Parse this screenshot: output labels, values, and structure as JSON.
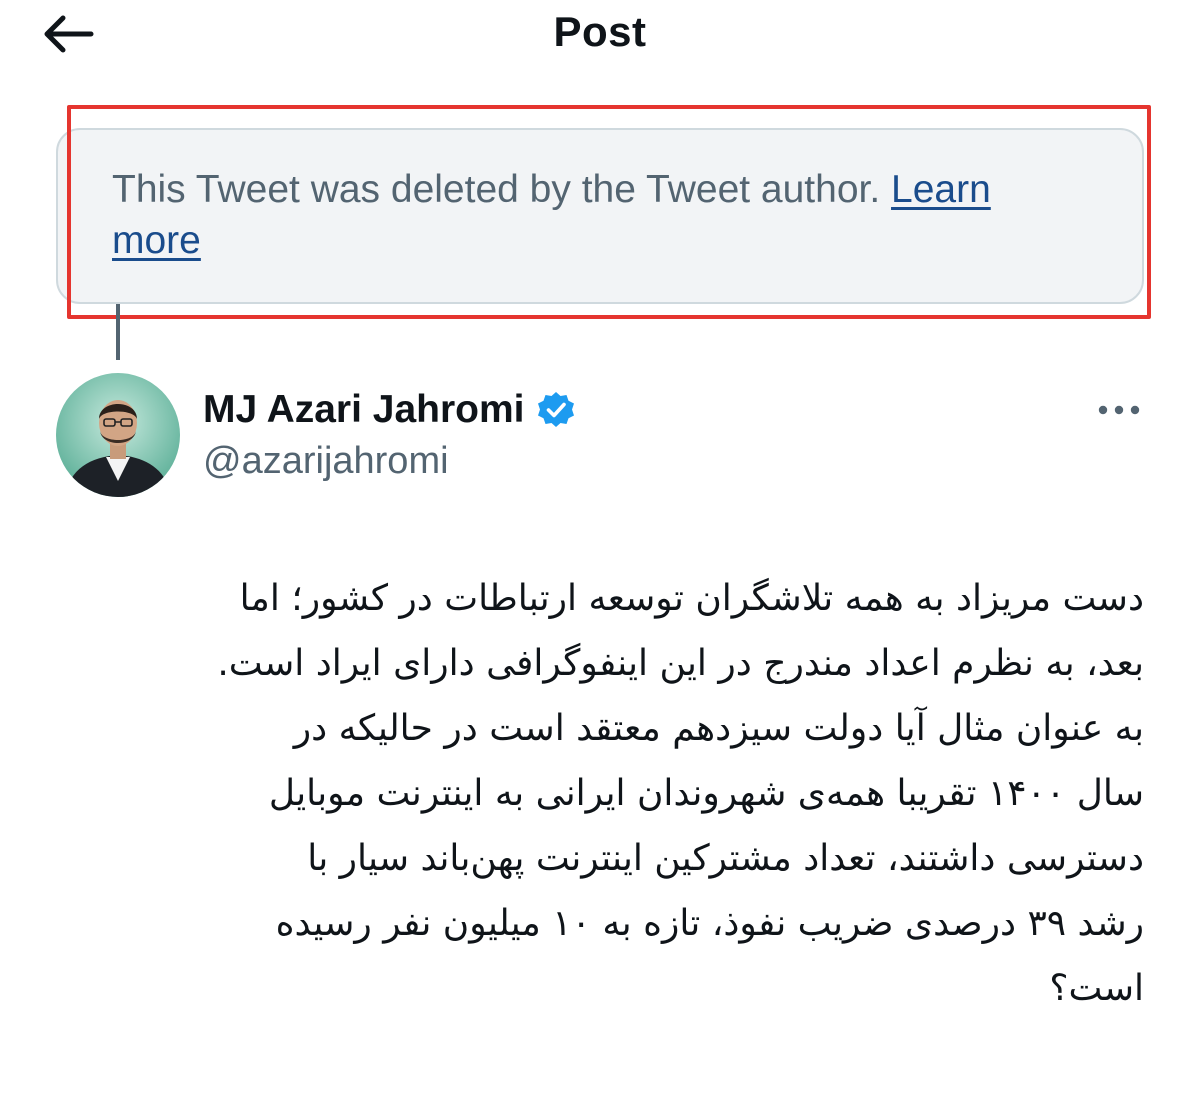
{
  "header": {
    "title": "Post",
    "back_icon": "arrow-left-icon"
  },
  "notice": {
    "text": "This Tweet was deleted by the Tweet author. ",
    "link": "Learn more"
  },
  "author": {
    "name": "MJ Azari Jahromi",
    "handle": "@azarijahromi",
    "verified": true,
    "verified_color": "#1d9bf0",
    "more_icon": "more-horizontal-icon"
  },
  "tweet": {
    "lines": [
      "دست مریزاد  به همه تلاشگران توسعه ارتباطات در کشور؛ اما",
      "بعد، به نظرم اعداد مندرج در این اینفوگرافی دارای ایراد است.",
      "به عنوان مثال آیا دولت سیزدهم معتقد است در حالیکه در",
      "سال ۱۴۰۰ تقریبا همه‌ی شهروندان ایرانی به اینترنت موبایل",
      "دسترسی داشتند، تعداد مشترکین اینترنت پهن‌باند سیار با",
      "رشد ۳۹ درصدی ضریب نفوذ، تازه به ۱۰ میلیون نفر رسیده",
      "است؟"
    ]
  },
  "colors": {
    "highlight_border": "#e5352f",
    "notice_background": "#f2f4f6",
    "secondary_text": "#536471",
    "link": "#1a4c8c"
  }
}
